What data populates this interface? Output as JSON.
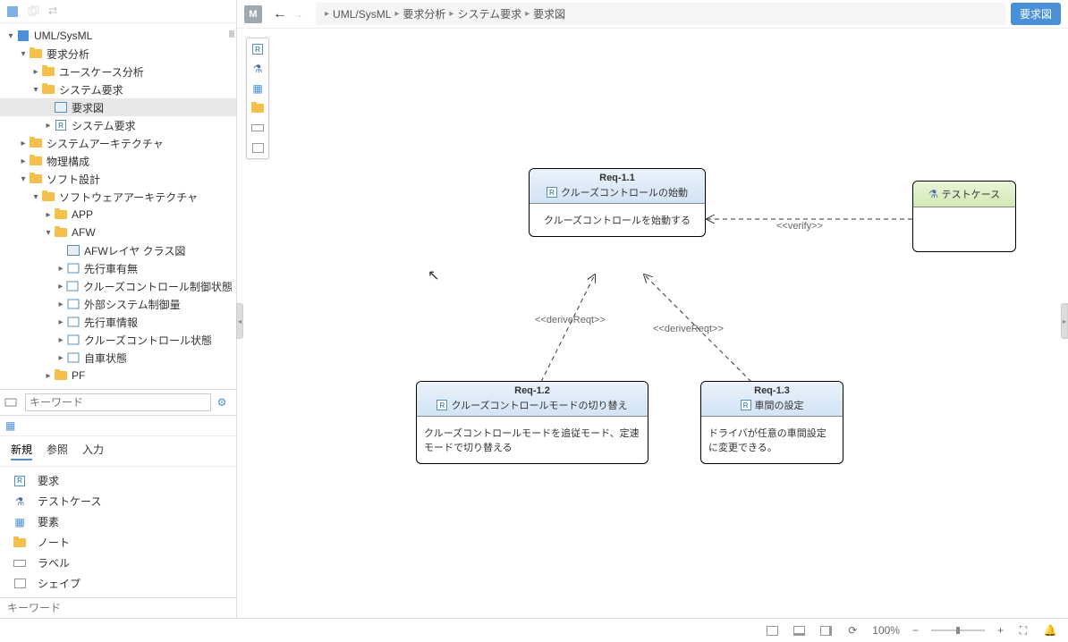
{
  "toolbar": {
    "root_label": "UML/SysML"
  },
  "tree": [
    {
      "depth": 0,
      "arrow": "▾",
      "icon": "root",
      "label": "UML/SysML"
    },
    {
      "depth": 1,
      "arrow": "▾",
      "icon": "folder",
      "label": "要求分析"
    },
    {
      "depth": 2,
      "arrow": "▸",
      "icon": "folder",
      "label": "ユースケース分析"
    },
    {
      "depth": 2,
      "arrow": "▾",
      "icon": "folder",
      "label": "システム要求"
    },
    {
      "depth": 3,
      "arrow": "",
      "icon": "diagram",
      "label": "要求図",
      "selected": true
    },
    {
      "depth": 3,
      "arrow": "▸",
      "icon": "r",
      "label": "システム要求"
    },
    {
      "depth": 1,
      "arrow": "▸",
      "icon": "folder",
      "label": "システムアーキテクチャ"
    },
    {
      "depth": 1,
      "arrow": "▸",
      "icon": "folder",
      "label": "物理構成"
    },
    {
      "depth": 1,
      "arrow": "▾",
      "icon": "folder",
      "label": "ソフト設計"
    },
    {
      "depth": 2,
      "arrow": "▾",
      "icon": "folder",
      "label": "ソフトウェアアーキテクチャ"
    },
    {
      "depth": 3,
      "arrow": "▸",
      "icon": "folder",
      "label": "APP"
    },
    {
      "depth": 3,
      "arrow": "▾",
      "icon": "folder",
      "label": "AFW"
    },
    {
      "depth": 4,
      "arrow": "",
      "icon": "diagram",
      "label": "AFWレイヤ クラス図"
    },
    {
      "depth": 4,
      "arrow": "▸",
      "icon": "block",
      "label": "先行車有無"
    },
    {
      "depth": 4,
      "arrow": "▸",
      "icon": "block",
      "label": "クルーズコントロール制御状態"
    },
    {
      "depth": 4,
      "arrow": "▸",
      "icon": "block",
      "label": "外部システム制御量"
    },
    {
      "depth": 4,
      "arrow": "▸",
      "icon": "block",
      "label": "先行車情報"
    },
    {
      "depth": 4,
      "arrow": "▸",
      "icon": "block",
      "label": "クルーズコントロール状態"
    },
    {
      "depth": 4,
      "arrow": "▸",
      "icon": "block",
      "label": "自車状態"
    },
    {
      "depth": 3,
      "arrow": "▸",
      "icon": "folder",
      "label": "PF"
    }
  ],
  "filter": {
    "placeholder": "キーワード"
  },
  "palette": {
    "tabs": [
      "新規",
      "参照",
      "入力"
    ],
    "active_tab": "新規",
    "items": [
      {
        "icon": "r",
        "label": "要求"
      },
      {
        "icon": "flask",
        "label": "テストケース"
      },
      {
        "icon": "elements",
        "label": "要素"
      },
      {
        "icon": "folder",
        "label": "ノート"
      },
      {
        "icon": "label",
        "label": "ラベル"
      },
      {
        "icon": "shape",
        "label": "シェイプ"
      }
    ],
    "search_placeholder": "キーワード"
  },
  "editor": {
    "model_button": "M",
    "breadcrumb": [
      "UML/SysML",
      "要求分析",
      "システム要求",
      "要求図"
    ],
    "diagram_type": "要求図"
  },
  "diagram": {
    "req1_1": {
      "id": "Req-1.1",
      "title": "クルーズコントロールの始動",
      "body": "クルーズコントロールを始動する"
    },
    "req1_2": {
      "id": "Req-1.2",
      "title": "クルーズコントロールモードの切り替え",
      "body": "クルーズコントロールモードを追従モード、定速モードで切り替える"
    },
    "req1_3": {
      "id": "Req-1.3",
      "title": "車間の設定",
      "body": "ドライバが任意の車間設定に変更できる。"
    },
    "testcase": {
      "title": "テストケース"
    },
    "labels": {
      "verify": "<<verify>>",
      "derive1": "<<deriveReqt>>",
      "derive2": "<<deriveReqt>>"
    }
  },
  "status": {
    "zoom": "100%",
    "minus": "−",
    "plus": "+"
  }
}
